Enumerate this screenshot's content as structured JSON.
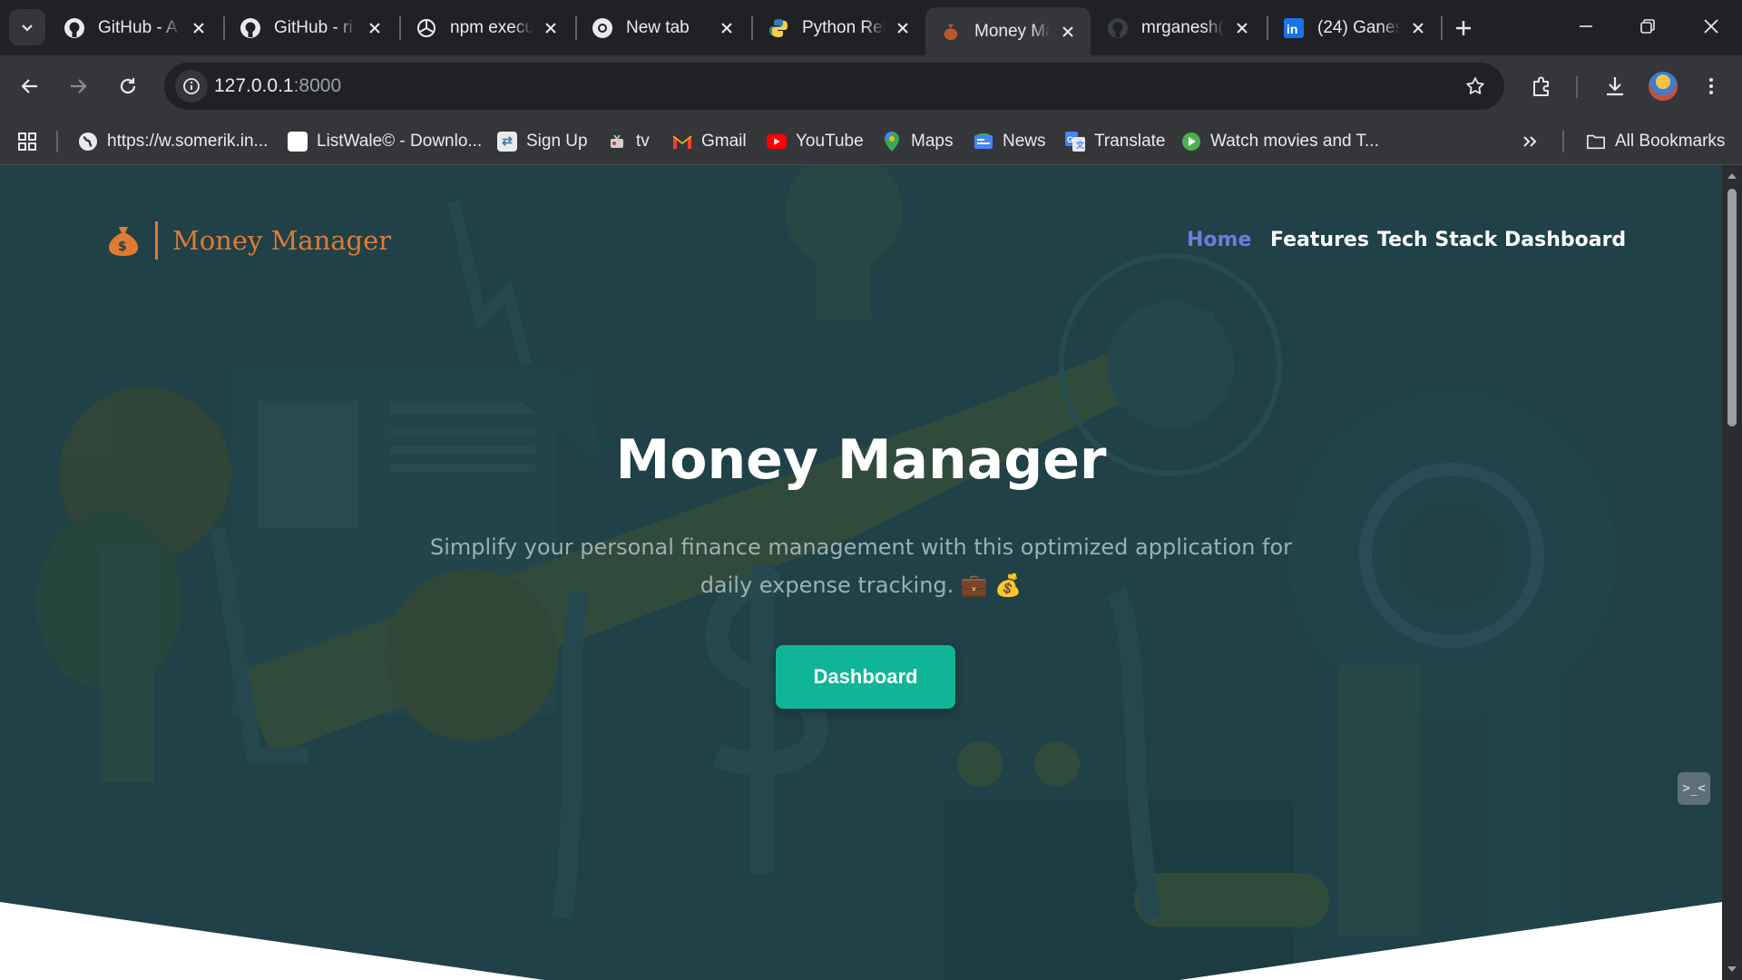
{
  "browser": {
    "tabs": [
      {
        "title": "GitHub - A",
        "icon": "github-icon"
      },
      {
        "title": "GitHub - ri",
        "icon": "github-icon"
      },
      {
        "title": "npm execu",
        "icon": "openai-icon"
      },
      {
        "title": "New tab",
        "icon": "chrome-icon"
      },
      {
        "title": "Python Rel",
        "icon": "python-icon"
      },
      {
        "title": "Money Ma",
        "icon": "money-bag-icon",
        "active": true
      },
      {
        "title": "mrganesh(",
        "icon": "github-icon"
      },
      {
        "title": "(24) Ganes",
        "icon": "linkedin-icon"
      }
    ],
    "url_host": "127.0.0.1",
    "url_port": ":8000",
    "bookmarks": [
      {
        "label": "https://w.somerik.in...",
        "icon": "globe-icon"
      },
      {
        "label": "ListWale© - Downlo...",
        "icon": "page-icon"
      },
      {
        "label": "Sign Up",
        "icon": "signup-icon"
      },
      {
        "label": "tv",
        "icon": "tv-icon"
      },
      {
        "label": "Gmail",
        "icon": "gmail-icon"
      },
      {
        "label": "YouTube",
        "icon": "youtube-icon"
      },
      {
        "label": "Maps",
        "icon": "maps-icon"
      },
      {
        "label": "News",
        "icon": "news-icon"
      },
      {
        "label": "Translate",
        "icon": "translate-icon"
      },
      {
        "label": "Watch movies and T...",
        "icon": "play-icon"
      }
    ],
    "all_bookmarks_label": "All Bookmarks"
  },
  "site": {
    "brand_name": "Money Manager",
    "nav": [
      {
        "label": "Home",
        "active": true
      },
      {
        "label": "Features"
      },
      {
        "label": "Tech Stack"
      },
      {
        "label": "Dashboard"
      }
    ],
    "hero_title": "Money Manager",
    "hero_subtitle": "Simplify your personal finance management with this optimized application for daily expense tracking. 💼 💰",
    "cta_label": "Dashboard",
    "widget_glyph": ">_<"
  },
  "colors": {
    "brand_orange": "#e07b34",
    "nav_active": "#6f7bdc",
    "cta": "#10b597",
    "hero_bg": "#1f4147"
  }
}
